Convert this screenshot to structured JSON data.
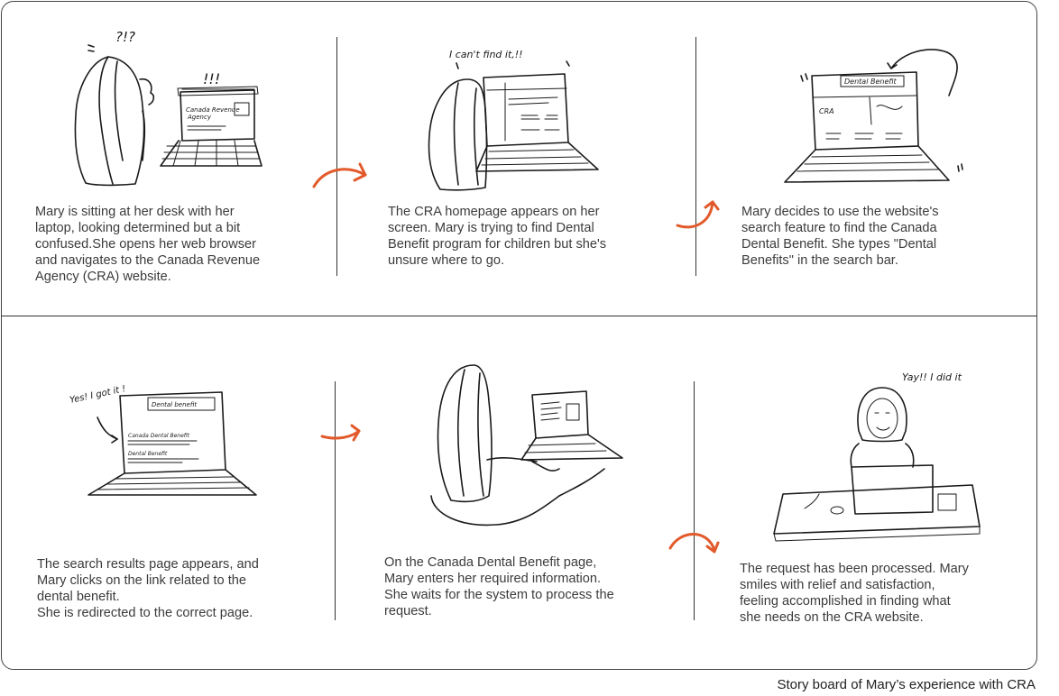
{
  "panels": [
    {
      "caption": "Mary is sitting at her desk with her\nlaptop, looking determined but a bit\nconfused.She opens her web browser\nand navigates to the Canada Revenue\nAgency (CRA) website.",
      "sketch_text": [
        "?!?",
        "!!!",
        "Canada Revenue",
        "Agency"
      ]
    },
    {
      "caption": "The CRA homepage appears on her\nscreen. Mary is trying to find   Dental\nBenefit program for children but she's\nunsure where to go.",
      "sketch_text": [
        "I can't find it,!!"
      ]
    },
    {
      "caption": "Mary decides to use the website's\nsearch feature to find the Canada\nDental Benefit. She types \"Dental\nBenefits\" in the search bar.",
      "sketch_text": [
        "Dental Benefit",
        "CRA"
      ]
    },
    {
      "caption": "The search results page appears, and\nMary clicks on the link related to the\ndental benefit.\nShe is redirected to the correct page.",
      "sketch_text": [
        "Yes! I got it !",
        "Dental benefit",
        "Canada Dental Benefit",
        "Dental Benefit"
      ]
    },
    {
      "caption": "On the Canada Dental Benefit page,\nMary enters her   required information.\nShe waits for the system to process the\nrequest.",
      "sketch_text": []
    },
    {
      "caption": "The request has been processed. Mary\nsmiles with relief and satisfaction,\nfeeling accomplished in finding what\nshe needs on the CRA website.",
      "sketch_text": [
        "Yay!! I did it"
      ]
    }
  ],
  "footer": "Story board of Mary’s experience with CRA",
  "colors": {
    "arrow": "#e25a2b",
    "line": "#333333",
    "text": "#3b3b3b"
  }
}
